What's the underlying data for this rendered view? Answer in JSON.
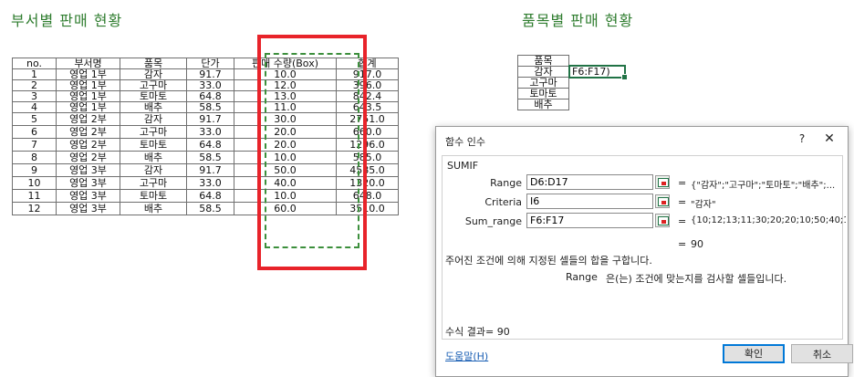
{
  "titles": {
    "left": "부서별 판매 현황",
    "right": "품목별 판매 현황"
  },
  "main_table": {
    "headers": [
      "no.",
      "부서명",
      "품목",
      "단가",
      "판매 수량(Box)",
      "합계"
    ],
    "rows": [
      [
        "1",
        "영업 1부",
        "감자",
        "91.7",
        "10.0",
        "917.0"
      ],
      [
        "2",
        "영업 1부",
        "고구마",
        "33.0",
        "12.0",
        "396.0"
      ],
      [
        "3",
        "영업 1부",
        "토마토",
        "64.8",
        "13.0",
        "842.4"
      ],
      [
        "4",
        "영업 1부",
        "배추",
        "58.5",
        "11.0",
        "643.5"
      ],
      [
        "5",
        "영업 2부",
        "감자",
        "91.7",
        "30.0",
        "2751.0"
      ],
      [
        "6",
        "영업 2부",
        "고구마",
        "33.0",
        "20.0",
        "660.0"
      ],
      [
        "7",
        "영업 2부",
        "토마토",
        "64.8",
        "20.0",
        "1296.0"
      ],
      [
        "8",
        "영업 2부",
        "배추",
        "58.5",
        "10.0",
        "585.0"
      ],
      [
        "9",
        "영업 3부",
        "감자",
        "91.7",
        "50.0",
        "4585.0"
      ],
      [
        "10",
        "영업 3부",
        "고구마",
        "33.0",
        "40.0",
        "1320.0"
      ],
      [
        "11",
        "영업 3부",
        "토마토",
        "64.8",
        "10.0",
        "648.0"
      ],
      [
        "12",
        "영업 3부",
        "배추",
        "58.5",
        "60.0",
        "3510.0"
      ]
    ]
  },
  "item_table": {
    "header": "품목",
    "items": [
      "감자",
      "고구마",
      "토마토",
      "배추"
    ],
    "active_cell_formula": "F6:F17)"
  },
  "dialog": {
    "title": "함수 인수",
    "help": "?",
    "close": "✕",
    "function_name": "SUMIF",
    "args": [
      {
        "label": "Range",
        "value": "D6:D17",
        "result": "{\"감자\";\"고구마\";\"토마토\";\"배추\";..."
      },
      {
        "label": "Criteria",
        "value": "I6",
        "result": "\"감자\""
      },
      {
        "label": "Sum_range",
        "value": "F6:F17",
        "result": "{10;12;13;11;30;20;20;10;50;40;1..."
      }
    ],
    "equals": "=",
    "result_value": "90",
    "description": "주어진 조건에 의해 지정된 셀들의 합을 구합니다.",
    "arg_description_name": "Range",
    "arg_description_text": "은(는) 조건에 맞는지를 검사할 셀들입니다.",
    "formula_result": "수식 결과=  90",
    "help_link": "도움말(H)",
    "ok": "확인",
    "cancel": "취소"
  },
  "colors": {
    "title_green": "#2f7d2f",
    "highlight_red": "#e8232a",
    "dash_green": "#3c8f3c",
    "excel_green": "#217346"
  }
}
